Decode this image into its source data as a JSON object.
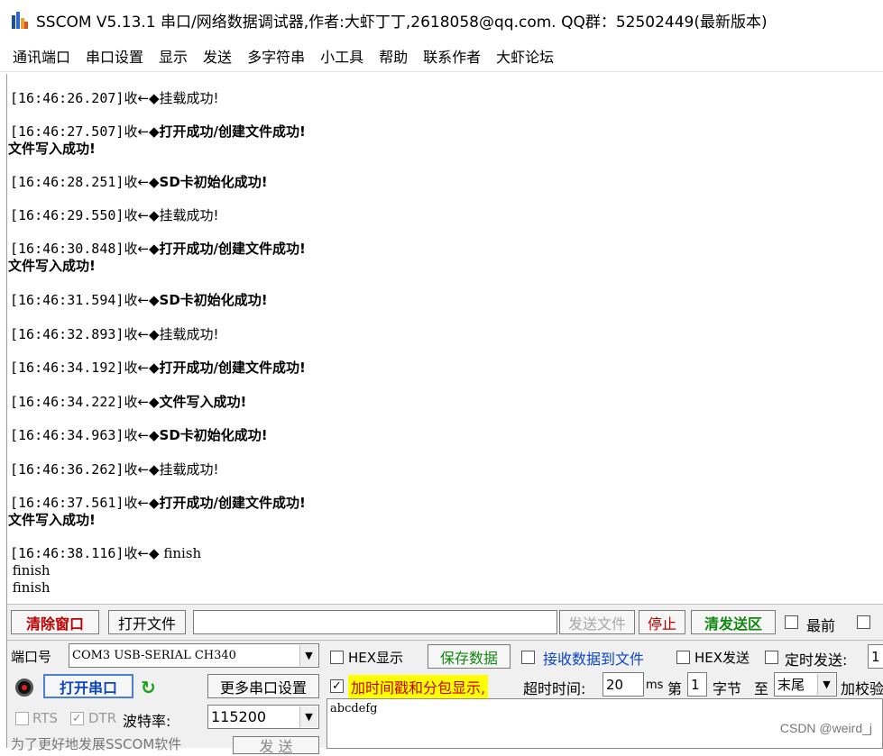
{
  "window": {
    "title": "SSCOM V5.13.1 串口/网络数据调试器,作者:大虾丁丁,2618058@qq.com. QQ群：52502449(最新版本)"
  },
  "menu": [
    "通讯端口",
    "串口设置",
    "显示",
    "发送",
    "多字符串",
    "小工具",
    "帮助",
    "联系作者",
    "大虾论坛"
  ],
  "receive_log": [
    {
      "time": "[16:46:26.207]",
      "dir": "收←◆",
      "text": "挂载成功!",
      "bold": false,
      "extra": ""
    },
    {
      "time": "[16:46:27.507]",
      "dir": "收←◆",
      "text": "打开成功/创建文件成功!",
      "bold": true,
      "extra": "文件写入成功!"
    },
    {
      "time": "[16:46:28.251]",
      "dir": "收←◆",
      "text": "SD卡初始化成功!",
      "bold": true,
      "extra": ""
    },
    {
      "time": "[16:46:29.550]",
      "dir": "收←◆",
      "text": "挂载成功!",
      "bold": false,
      "extra": ""
    },
    {
      "time": "[16:46:30.848]",
      "dir": "收←◆",
      "text": "打开成功/创建文件成功!",
      "bold": true,
      "extra": "文件写入成功!"
    },
    {
      "time": "[16:46:31.594]",
      "dir": "收←◆",
      "text": "SD卡初始化成功!",
      "bold": true,
      "extra": ""
    },
    {
      "time": "[16:46:32.893]",
      "dir": "收←◆",
      "text": "挂载成功!",
      "bold": false,
      "extra": ""
    },
    {
      "time": "[16:46:34.192]",
      "dir": "收←◆",
      "text": "打开成功/创建文件成功!",
      "bold": true,
      "extra": ""
    },
    {
      "time": "[16:46:34.222]",
      "dir": "收←◆",
      "text": "文件写入成功!",
      "bold": true,
      "extra": ""
    },
    {
      "time": "[16:46:34.963]",
      "dir": "收←◆",
      "text": "SD卡初始化成功!",
      "bold": true,
      "extra": ""
    },
    {
      "time": "[16:46:36.262]",
      "dir": "收←◆",
      "text": "挂载成功!",
      "bold": false,
      "extra": ""
    },
    {
      "time": "[16:46:37.561]",
      "dir": "收←◆",
      "text": "打开成功/创建文件成功!",
      "bold": true,
      "extra": "文件写入成功!"
    },
    {
      "time": "[16:46:38.116]",
      "dir": "收←◆",
      "text": " finish",
      "bold": false,
      "extra": " finish\n finish"
    }
  ],
  "toolbar": {
    "clear_window": "清除窗口",
    "open_file": "打开文件",
    "send_file": "发送文件",
    "stop": "停止",
    "clear_send": "清发送区",
    "topmost": "最前"
  },
  "port": {
    "port_label": "端口号",
    "port_value": "COM3 USB-SERIAL CH340",
    "open_port": "打开串口",
    "more_settings": "更多串口设置",
    "rts": "RTS",
    "dtr": "DTR",
    "baud_label": "波特率:",
    "baud_value": "115200",
    "promo": "为了更好地发展SSCOM软件",
    "send": "发 送"
  },
  "options": {
    "hex_display": "HEX显示",
    "save_data": "保存数据",
    "recv_to_file": "接收数据到文件",
    "hex_send": "HEX发送",
    "timed_send": "定时发送:",
    "timed_value": "1",
    "timestamp": "加时间戳和分包显示,",
    "timeout_label": "超时时间:",
    "timeout_value": "20",
    "ms": "ms",
    "nth": "第",
    "byte_value": "1",
    "byte_label": "字节",
    "to_label": "至",
    "tail_value": "末尾",
    "checksum": "加校验"
  },
  "send_area": {
    "text": "abcdefg"
  },
  "watermark": "CSDN @weird_j"
}
